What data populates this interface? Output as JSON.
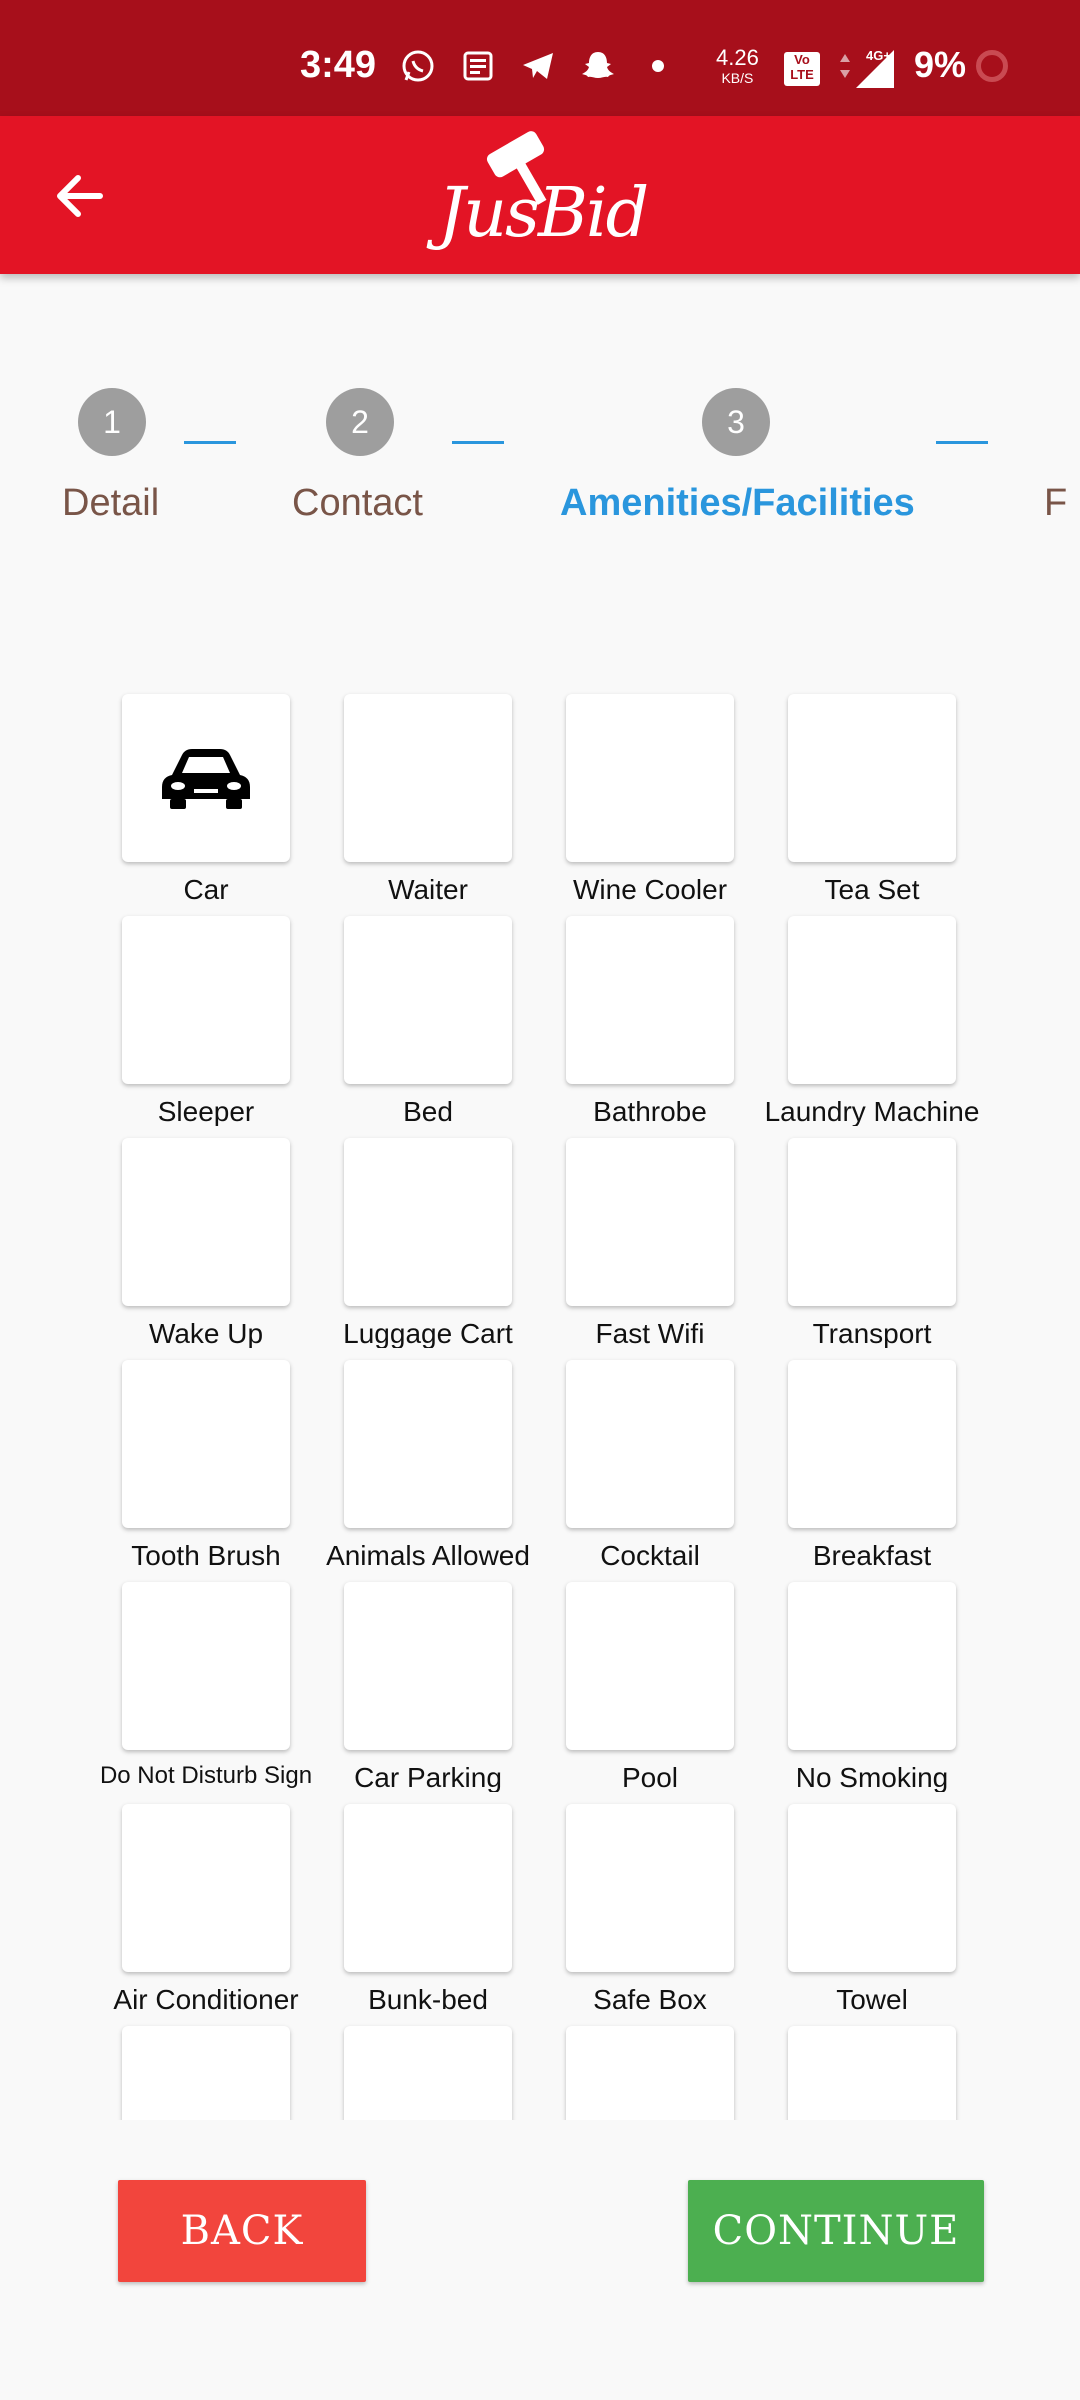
{
  "status_bar": {
    "time": "3:49",
    "speed_value": "4.26",
    "speed_unit": "KB/S",
    "volte": "Vo LTE",
    "network": "4G+",
    "battery": "9%",
    "icons": [
      "whatsapp-icon",
      "news-icon",
      "telegram-icon",
      "snapchat-icon",
      "dot-icon"
    ]
  },
  "app_bar": {
    "logo_text": "JusBid"
  },
  "stepper": {
    "steps": [
      {
        "number": "1",
        "label": "Detail"
      },
      {
        "number": "2",
        "label": "Contact"
      },
      {
        "number": "3",
        "label": "Amenities/Facilities"
      },
      {
        "number": "",
        "label": "F"
      }
    ],
    "active_index": 2
  },
  "amenities": [
    "Car",
    "Waiter",
    "Wine Cooler",
    "Tea Set",
    "Sleeper",
    "Bed",
    "Bathrobe",
    "Laundry Machine",
    "Wake Up",
    "Luggage Cart",
    "Fast Wifi",
    "Transport",
    "Tooth Brush",
    "Animals Allowed",
    "Cocktail",
    "Breakfast",
    "Do Not Disturb Sign",
    "Car Parking",
    "Pool",
    "No Smoking",
    "Air Conditioner",
    "Bunk-bed",
    "Safe Box",
    "Towel",
    "",
    "",
    "",
    ""
  ],
  "buttons": {
    "back": "BACK",
    "continue": "CONTINUE"
  },
  "colors": {
    "status_bar": "#a70f1b",
    "app_bar": "#e31425",
    "active_step": "#2a96dd",
    "back_button": "#f2453d",
    "continue_button": "#4caf50"
  }
}
